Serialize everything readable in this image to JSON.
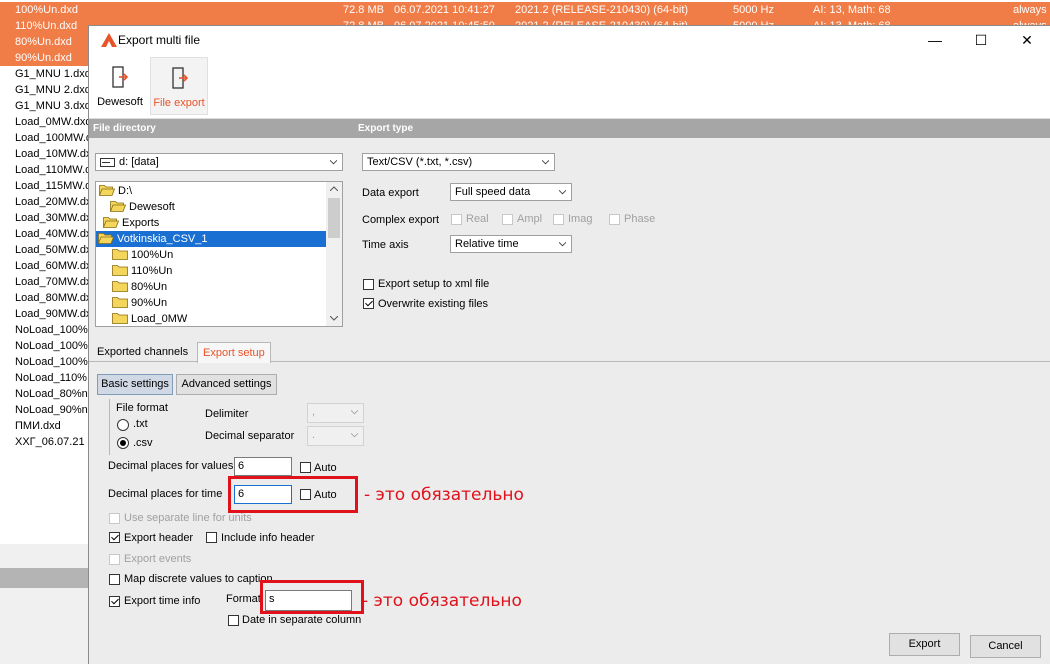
{
  "background": {
    "selected_rows": [
      {
        "name": "100%Un.dxd",
        "size": "72.8 MB",
        "date": "06.07.2021 10:41:27",
        "version": "2021.2 (RELEASE-210430) (64-bit)",
        "rate": "5000 Hz",
        "channels": "AI: 13, Math: 68",
        "mode": "always"
      },
      {
        "name": "110%Un.dxd",
        "size": "72.8 MB",
        "date": "06.07.2021 10:45:50",
        "version": "2021.2 (RELEASE-210430) (64-bit)",
        "rate": "5000 Hz",
        "channels": "AI: 13, Math: 68",
        "mode": "always"
      },
      {
        "name": "80%Un.dxd"
      },
      {
        "name": "90%Un.dxd"
      }
    ],
    "rows": [
      "G1_MNU 1.dxd",
      "G1_MNU 2.dxd",
      "G1_MNU 3.dxd",
      "Load_0MW.dxd",
      "Load_100MW.dx",
      "Load_10MW.dxd",
      "Load_110MW.dx",
      "Load_115MW.dx",
      "Load_20MW.dxd",
      "Load_30MW.dxd",
      "Load_40MW.dxd",
      "Load_50MW.dxd",
      "Load_60MW.dxd",
      "Load_70MW.dxd",
      "Load_80MW.dxd",
      "Load_90MW.dxd",
      "NoLoad_100%",
      "NoLoad_100%",
      "NoLoad_100%",
      "NoLoad_110%",
      "NoLoad_80%n.",
      "NoLoad_90%n.",
      "ПМИ.dxd",
      "ХХГ_06.07.21 1"
    ],
    "accent_color": "#f07c47"
  },
  "dialog": {
    "title": "Export multi file",
    "window_buttons": {
      "minimize": "—",
      "maximize": "☐",
      "close": "✕"
    },
    "ribbon": [
      {
        "label": "Dewesoft",
        "active": false
      },
      {
        "label": "File export",
        "active": true
      }
    ],
    "file_directory": {
      "header": "File directory",
      "drive": "d: [data]",
      "tree": [
        {
          "label": "D:\\",
          "level": 0,
          "selected": false
        },
        {
          "label": "Dewesoft",
          "level": 1,
          "selected": false
        },
        {
          "label": "Exports",
          "level": 2,
          "selected": false
        },
        {
          "label": "Votkinskia_CSV_1",
          "level": 3,
          "selected": true
        },
        {
          "label": "100%Un",
          "level": 4,
          "selected": false
        },
        {
          "label": "110%Un",
          "level": 4,
          "selected": false
        },
        {
          "label": "80%Un",
          "level": 4,
          "selected": false
        },
        {
          "label": "90%Un",
          "level": 4,
          "selected": false
        },
        {
          "label": "Load_0MW",
          "level": 4,
          "selected": false
        }
      ]
    },
    "export_type": {
      "header": "Export type",
      "type_value": "Text/CSV (*.txt, *.csv)",
      "data_export_label": "Data export",
      "data_export_value": "Full speed data",
      "complex_export_label": "Complex export",
      "complex_options": [
        "Real",
        "Ampl",
        "Imag",
        "Phase"
      ],
      "time_axis_label": "Time axis",
      "time_axis_value": "Relative time",
      "export_setup_xml": "Export setup to xml file",
      "overwrite_files": "Overwrite existing files"
    },
    "tabs": [
      {
        "label": "Exported channels",
        "active": false
      },
      {
        "label": "Export setup",
        "active": true
      }
    ],
    "subtabs": [
      {
        "label": "Basic settings",
        "active": true
      },
      {
        "label": "Advanced settings",
        "active": false
      }
    ],
    "settings": {
      "file_format_label": "File format",
      "format_txt": ".txt",
      "format_csv": ".csv",
      "delimiter_label": "Delimiter",
      "delimiter_value": ",",
      "decimal_sep_label": "Decimal separator",
      "decimal_sep_value": ".",
      "decimal_values_label": "Decimal places for values",
      "decimal_values": "6",
      "decimal_time_label": "Decimal places for time",
      "decimal_time": "6",
      "auto_label": "Auto",
      "separate_line_units": "Use separate line for units",
      "export_header": "Export header",
      "include_info_header": "Include info header",
      "export_events": "Export events",
      "map_discrete": "Map discrete values to caption",
      "export_time_info": "Export time info",
      "format_label": "Format",
      "format_value": "s",
      "date_separate": "Date in separate column"
    },
    "buttons": {
      "export": "Export",
      "cancel": "Cancel"
    }
  },
  "annotations": {
    "note1": "- это обязательно",
    "note2": "- это обязательно",
    "color": "#e0111b"
  }
}
